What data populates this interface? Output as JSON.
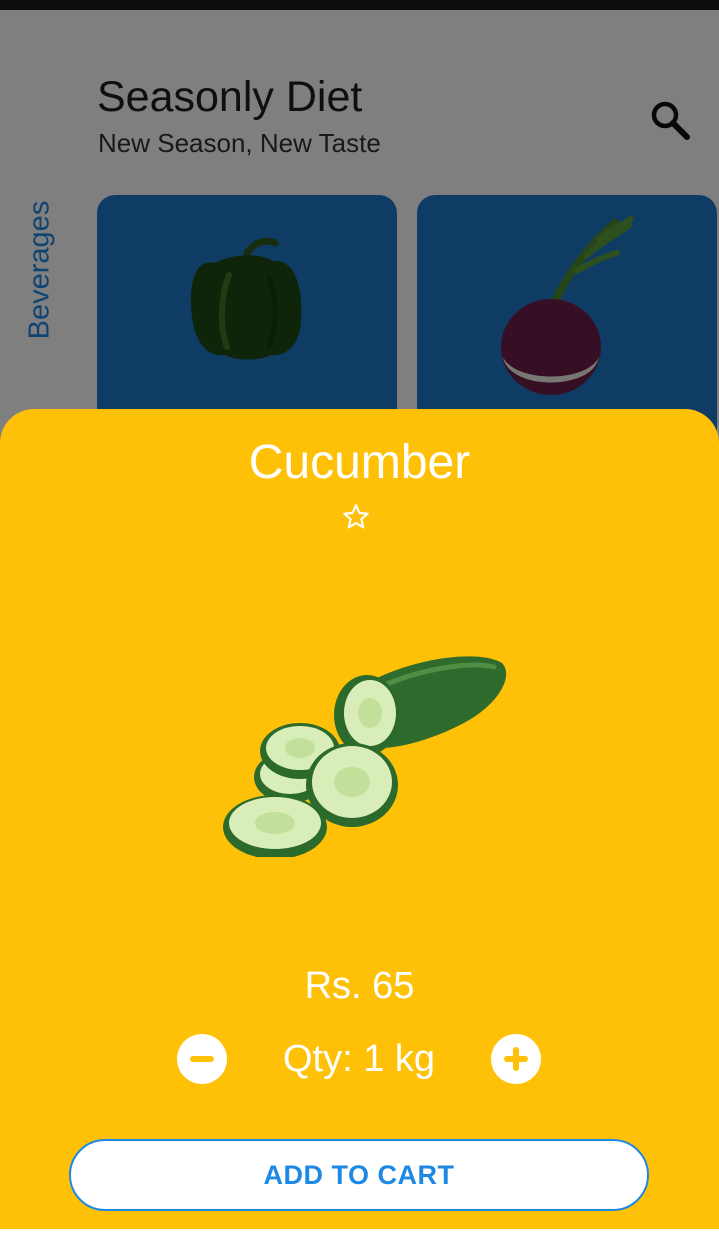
{
  "header": {
    "title": "Seasonly Diet",
    "subtitle": "New Season, New Taste",
    "search_icon": "search-icon"
  },
  "category_tab": {
    "label": "Beverages"
  },
  "product_cards": [
    {
      "image": "green bell pepper"
    },
    {
      "image": "turnip"
    }
  ],
  "detail_sheet": {
    "name": "Cucumber",
    "favorite_icon": "star-outline-icon",
    "image": "sliced cucumber",
    "price": "Rs. 65",
    "quantity_label": "Qty: 1 kg",
    "minus_icon": "minus-circle-icon",
    "plus_icon": "plus-circle-icon",
    "add_to_cart_label": "ADD TO CART"
  },
  "colors": {
    "sheet_background": "#ffc107",
    "card_background": "#1f78c8",
    "accent_blue": "#1e88e5",
    "status_bar": "#1a1a1a"
  }
}
